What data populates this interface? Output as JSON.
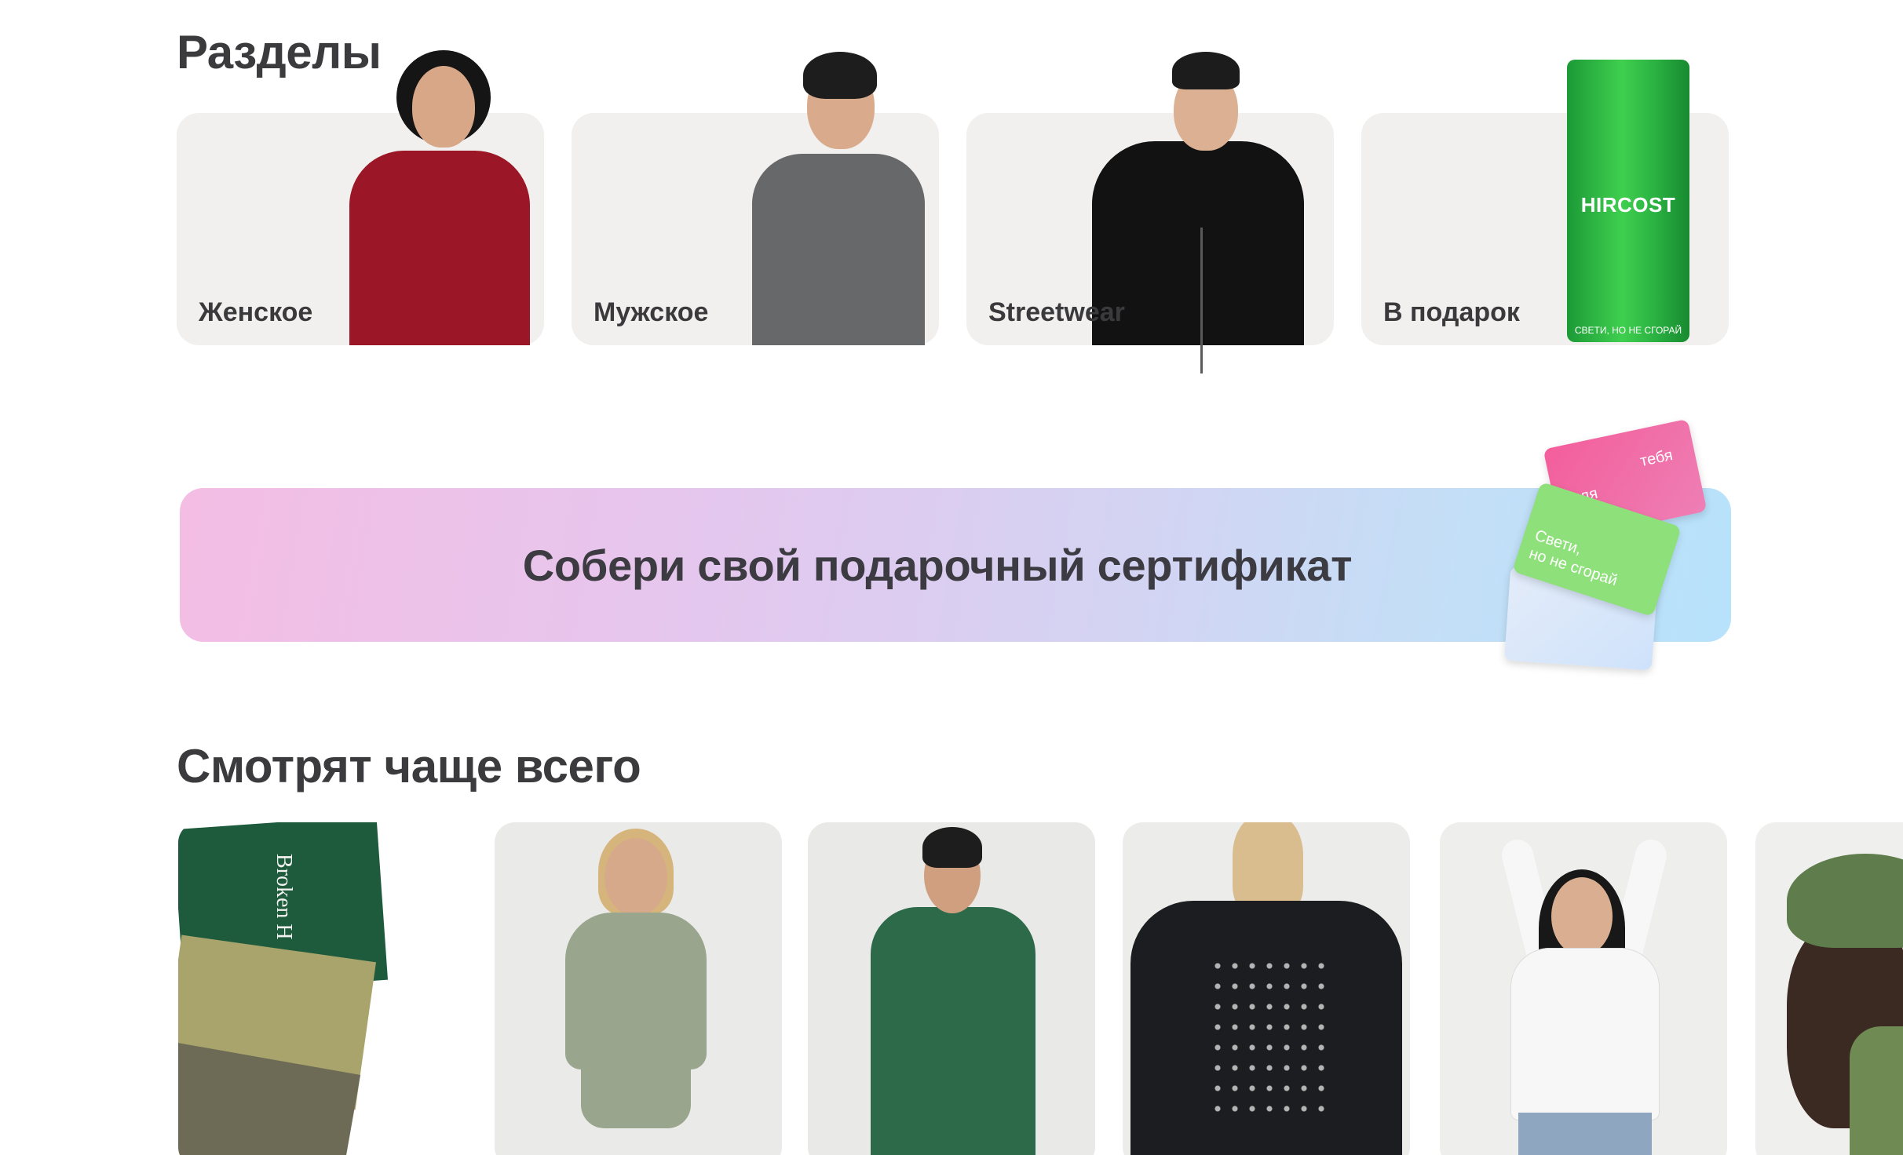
{
  "sections": {
    "title": "Разделы",
    "cards": [
      {
        "label": "Женское"
      },
      {
        "label": "Мужское"
      },
      {
        "label": "Streetwear"
      },
      {
        "label": "В подарок"
      }
    ],
    "gift_tube": {
      "brand": "HIRCOST",
      "slogan": "СВЕТИ, НО НЕ СГОРАЙ"
    }
  },
  "promo": {
    "text": "Собери свой подарочный сертификат",
    "cards": {
      "pink_for": "для",
      "pink_you": "тебя",
      "green_line1": "Свети,",
      "green_line2": "но не сгорай"
    }
  },
  "popular": {
    "title": "Смотрят чаще всего",
    "product_1_print": "Broken H"
  },
  "colors": {
    "heading": "#3b3b3e",
    "card_bg": "#f1f0ef",
    "tube_green": "#3fcf4f",
    "banner_start": "#f4bde4",
    "banner_end": "#b7e2fb"
  }
}
